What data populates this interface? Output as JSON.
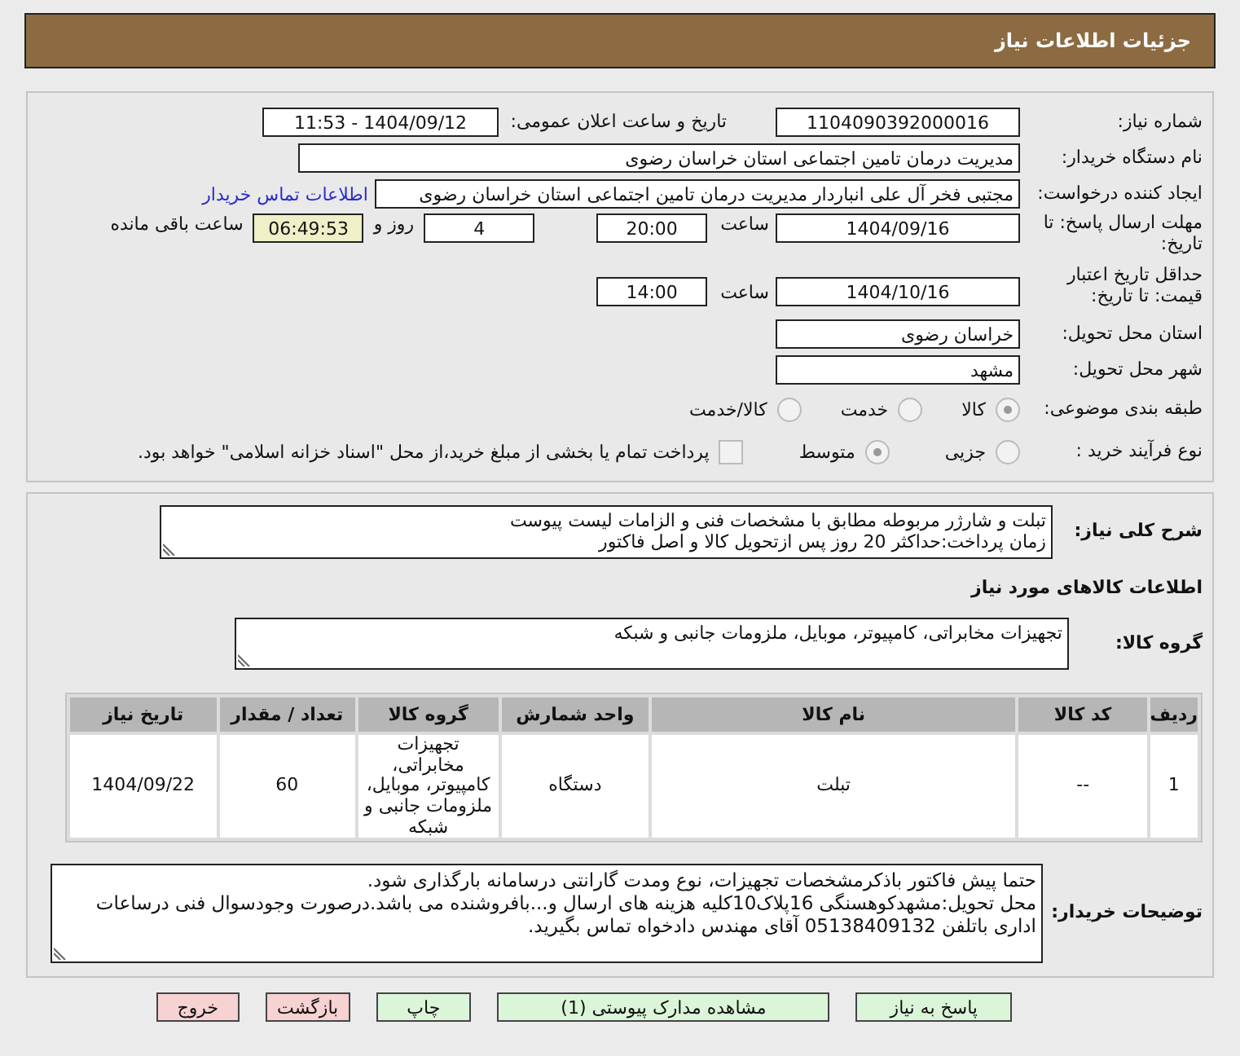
{
  "header": {
    "title": "جزئیات اطلاعات نیاز"
  },
  "need_number": {
    "label": "شماره نیاز:",
    "value": "1104090392000016"
  },
  "announce": {
    "label": "تاریخ و ساعت اعلان عمومی:",
    "value": "1404/09/12 - 11:53"
  },
  "buyer_org": {
    "label": "نام دستگاه خریدار:",
    "value": "مدیریت درمان تامین اجتماعی استان خراسان رضوی"
  },
  "requester": {
    "label": "ایجاد کننده درخواست:",
    "value": "مجتبی فخر آل علی انباردار مدیریت درمان تامین اجتماعی استان خراسان رضوی",
    "link": "اطلاعات تماس خریدار"
  },
  "deadline": {
    "label": "مهلت ارسال پاسخ: تا تاریخ:",
    "date": "1404/09/16",
    "time_label": "ساعت",
    "time": "20:00",
    "days": "4",
    "days_label": "روز و",
    "remaining": "06:49:53",
    "remaining_label": "ساعت باقی مانده"
  },
  "validity": {
    "label": "حداقل تاریخ اعتبار قیمت: تا تاریخ:",
    "date": "1404/10/16",
    "time_label": "ساعت",
    "time": "14:00"
  },
  "province": {
    "label": "استان محل تحویل:",
    "value": "خراسان رضوی"
  },
  "city": {
    "label": "شهر محل تحویل:",
    "value": "مشهد"
  },
  "category": {
    "label": "طبقه بندی موضوعی:",
    "options": [
      {
        "label": "کالا",
        "selected": true
      },
      {
        "label": "خدمت",
        "selected": false
      },
      {
        "label": "کالا/خدمت",
        "selected": false
      }
    ]
  },
  "process": {
    "label": "نوع فرآیند خرید :",
    "options": [
      {
        "label": "جزیی",
        "selected": false
      },
      {
        "label": "متوسط",
        "selected": true
      }
    ],
    "payment": {
      "checked": false,
      "label": "پرداخت تمام یا بخشی از مبلغ خرید،از محل \"اسناد خزانه اسلامی\" خواهد بود."
    }
  },
  "description": {
    "label": "شرح کلی نیاز:",
    "lines": [
      "تبلت و شارژر مربوطه مطابق با مشخصات فنی و الزامات لیست پیوست",
      "زمان پرداخت:حداکثر 20 روز پس ازتحویل کالا و اصل فاکتور"
    ]
  },
  "goods_heading": "اطلاعات کالاهای مورد نیاز",
  "goods_group": {
    "label": "گروه کالا:",
    "value": "تجهیزات مخابراتی، کامپیوتر، موبایل، ملزومات جانبی و شبکه"
  },
  "table": {
    "columns": [
      "ردیف",
      "کد کالا",
      "نام کالا",
      "واحد شمارش",
      "گروه کالا",
      "تعداد / مقدار",
      "تاریخ نیاز"
    ],
    "rows": [
      [
        "1",
        "--",
        "تبلت",
        "دستگاه",
        "تجهیزات مخابراتی، کامپیوتر، موبایل، ملزومات جانبی و شبکه",
        "60",
        "1404/09/22"
      ]
    ]
  },
  "buyer_notes": {
    "label": "توضیحات خریدار:",
    "lines": [
      "حتما پیش فاکتور باذکرمشخصات تجهیزات، نوع ومدت گارانتی درسامانه بارگذاری شود.",
      "محل تحویل:مشهدکوهسنگی 16پلاک10کلیه هزینه های ارسال و...بافروشنده می باشد.درصورت وجودسوال فنی درساعات اداری باتلفن 05138409132 آقای مهندس دادخواه تماس بگیرید."
    ]
  },
  "buttons": [
    {
      "label": "پاسخ به نیاز",
      "kind": "primary"
    },
    {
      "label": "مشاهده مدارک پیوستی (1)",
      "kind": "primary"
    },
    {
      "label": "چاپ",
      "kind": "primary"
    },
    {
      "label": "بازگشت",
      "kind": "danger"
    },
    {
      "label": "خروج",
      "kind": "danger"
    }
  ]
}
